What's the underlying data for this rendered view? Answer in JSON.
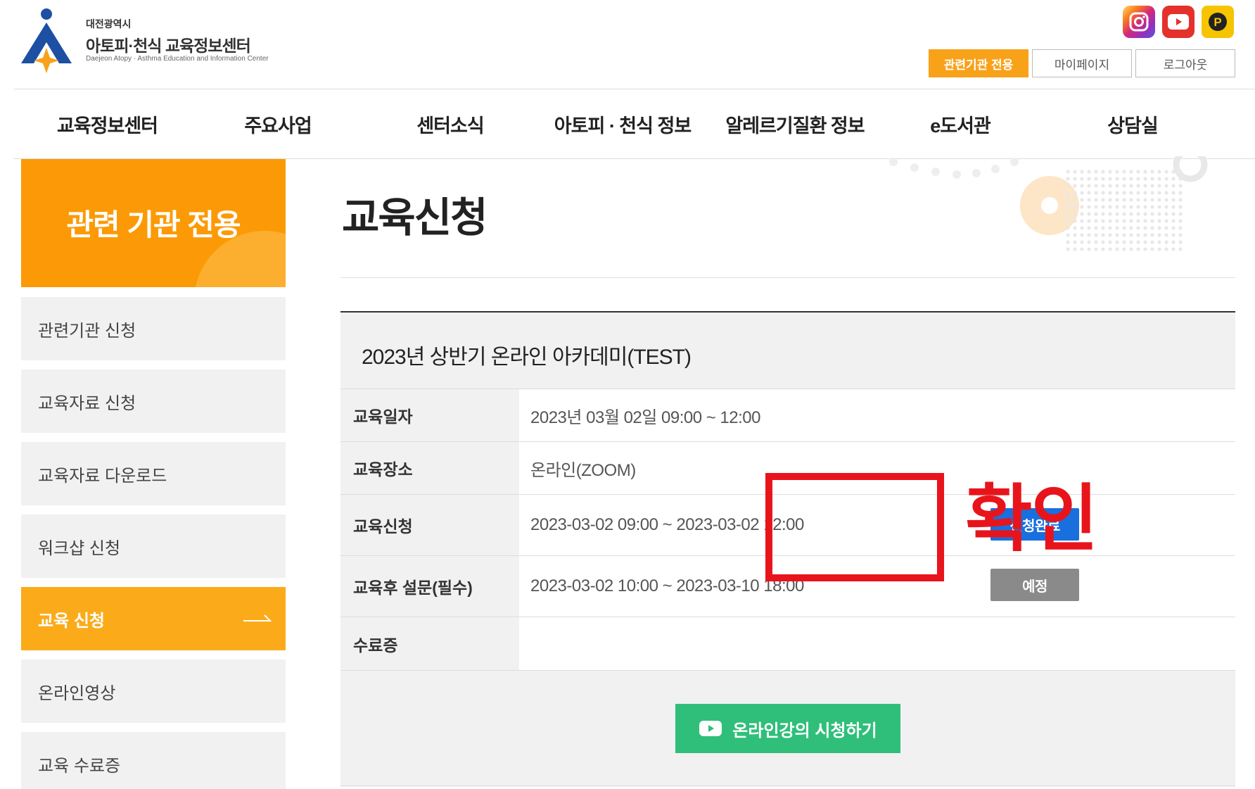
{
  "header": {
    "logo_small": "대전광역시",
    "logo_main": "아토피·천식 교육정보센터",
    "logo_en": "Daejeon Atopy · Asthma Education and Information Center",
    "sns": [
      "instagram-icon",
      "youtube-icon",
      "naver-post-icon"
    ],
    "util": [
      "관련기관 전용",
      "마이페이지",
      "로그아웃"
    ]
  },
  "gnb": [
    "교육정보센터",
    "주요사업",
    "센터소식",
    "아토피 · 천식 정보",
    "알레르기질환 정보",
    "e도서관",
    "상담실"
  ],
  "sidebar": {
    "title": "관련 기관 전용",
    "items": [
      "관련기관 신청",
      "교육자료 신청",
      "교육자료 다운로드",
      "워크샵 신청",
      "교육 신청",
      "온라인영상",
      "교육 수료증"
    ],
    "active_index": 4
  },
  "content": {
    "page_title": "교육신청",
    "course_title": "2023년 상반기 온라인 아카데미(TEST)",
    "rows": [
      {
        "label": "교육일자",
        "value": "2023년 03월 02일  09:00 ~ 12:00"
      },
      {
        "label": "교육장소",
        "value": "온라인(ZOOM)"
      },
      {
        "label": "교육신청",
        "value": "2023-03-02 09:00 ~ 2023-03-02 12:00",
        "badge": "신청완료"
      },
      {
        "label": "교육후 설문(필수)",
        "value": "2023-03-02 10:00 ~ 2023-03-10 18:00",
        "badge": "예정"
      },
      {
        "label": "수료증",
        "value": ""
      }
    ],
    "watch_button": "온라인강의 시청하기"
  },
  "annotation": {
    "text": "확인"
  },
  "colors": {
    "orange": "#fb9a06",
    "blue": "#1a6fde",
    "green": "#2fbf7a",
    "annotation_red": "#e8141c"
  }
}
